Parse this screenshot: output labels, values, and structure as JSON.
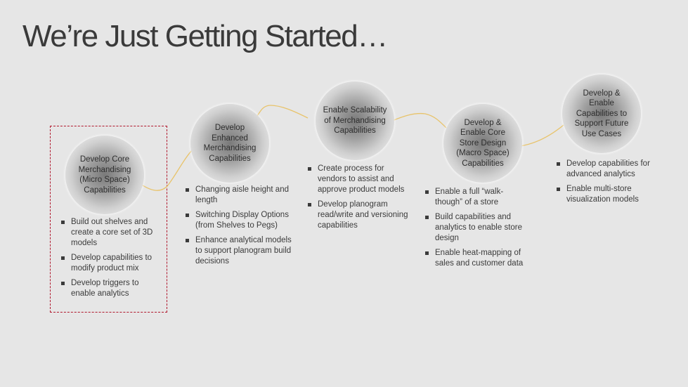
{
  "title": "We’re Just Getting Started…",
  "colors": {
    "connector": "#e8c36a",
    "highlight_border": "#b0162c",
    "background": "#e6e6e6"
  },
  "stages": [
    {
      "label": "Develop Core Merchandising (Micro Space) Capabilities",
      "highlighted": true,
      "bullets": [
        "Build out shelves and create a core set of 3D models",
        "Develop capabilities to modify product mix",
        "Develop triggers to enable analytics"
      ]
    },
    {
      "label": "Develop Enhanced Merchandising Capabilities",
      "highlighted": false,
      "bullets": [
        "Changing aisle height and length",
        "Switching Display Options (from Shelves to Pegs)",
        "Enhance analytical models to support planogram build decisions"
      ]
    },
    {
      "label": "Enable Scalability of Merchandising Capabilities",
      "highlighted": false,
      "bullets": [
        "Create process for vendors to assist and approve product models",
        "Develop planogram read/write and versioning capabilities"
      ]
    },
    {
      "label": "Develop & Enable Core Store Design (Macro Space) Capabilities",
      "highlighted": false,
      "bullets": [
        "Enable a full “walk-though” of a store",
        "Build capabilities and analytics to enable store design",
        "Enable heat-mapping of sales and customer data"
      ]
    },
    {
      "label": "Develop & Enable Capabilities to Support Future Use Cases",
      "highlighted": false,
      "bullets": [
        "Develop capabilities for advanced analytics",
        "Enable multi-store visualization models"
      ]
    }
  ]
}
